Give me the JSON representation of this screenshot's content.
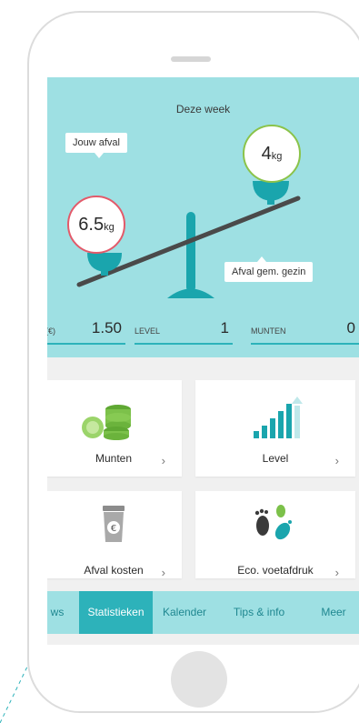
{
  "hero": {
    "title": "Deze week",
    "label_own": "Jouw afval",
    "label_avg": "Afval gem. gezin",
    "own_weight": {
      "value": "6.5",
      "unit": "kg"
    },
    "avg_weight": {
      "value": "4",
      "unit": "kg"
    }
  },
  "stats": [
    {
      "label": "(€)",
      "value": "1.50"
    },
    {
      "label": "LEVEL",
      "value": "1"
    },
    {
      "label": "MUNTEN",
      "value": "0"
    }
  ],
  "cards": [
    {
      "label": "Munten",
      "icon": "coins-icon"
    },
    {
      "label": "Level",
      "icon": "level-bars-icon"
    },
    {
      "label": "Afval kosten",
      "icon": "waste-bin-euro-icon"
    },
    {
      "label": "Eco. voetafdruk",
      "icon": "footprints-icon"
    }
  ],
  "chevron": "›",
  "tabs": [
    {
      "label": "ws",
      "active": false
    },
    {
      "label": "Statistieken",
      "active": true
    },
    {
      "label": "Kalender",
      "active": false
    },
    {
      "label": "Tips & info",
      "active": false
    },
    {
      "label": "Meer",
      "active": false
    }
  ],
  "colors": {
    "accent": "#2db2ba",
    "hero_bg": "#9ee0e3",
    "own_ring": "#e35a6a",
    "avg_ring": "#8bc34a",
    "coin_green": "#7cc14a"
  }
}
